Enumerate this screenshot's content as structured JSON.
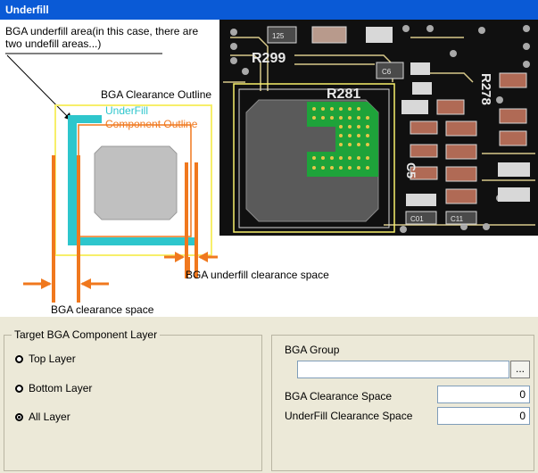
{
  "title": "Underfill",
  "diagram": {
    "note": "BGA underfill area(in this case, there are two undefill areas...)",
    "bga_clearance_outline": "BGA Clearance Outline",
    "underfill": "UnderFill",
    "component_outline": "Component Outline",
    "underfill_clearance_space": "BGA underfill clearance space",
    "bga_clearance_space": "BGA clearance space",
    "photo": {
      "labels": [
        "R299",
        "R281",
        "R278",
        "C5"
      ],
      "small_labels": [
        "125",
        "C6",
        "C01",
        "C11"
      ]
    }
  },
  "target_layer": {
    "legend": "Target BGA Component Layer",
    "options": [
      {
        "label": "Top Layer",
        "selected": false
      },
      {
        "label": "Bottom Layer",
        "selected": false
      },
      {
        "label": "All Layer",
        "selected": true
      }
    ]
  },
  "bga_settings": {
    "group_label": "BGA Group",
    "group_value": "",
    "browse_label": "...",
    "clearance_label": "BGA Clearance Space",
    "clearance_value": "0",
    "underfill_label": "UnderFill Clearance Space",
    "underfill_value": "0"
  },
  "colors": {
    "title_bar": "#0a5ad6",
    "underfill": "#2ec6cc",
    "orange_lines": "#f0781e",
    "bga_outline": "#f7ef6a",
    "pcb_background": "#101010",
    "bga_pads": "#1ea33a"
  }
}
